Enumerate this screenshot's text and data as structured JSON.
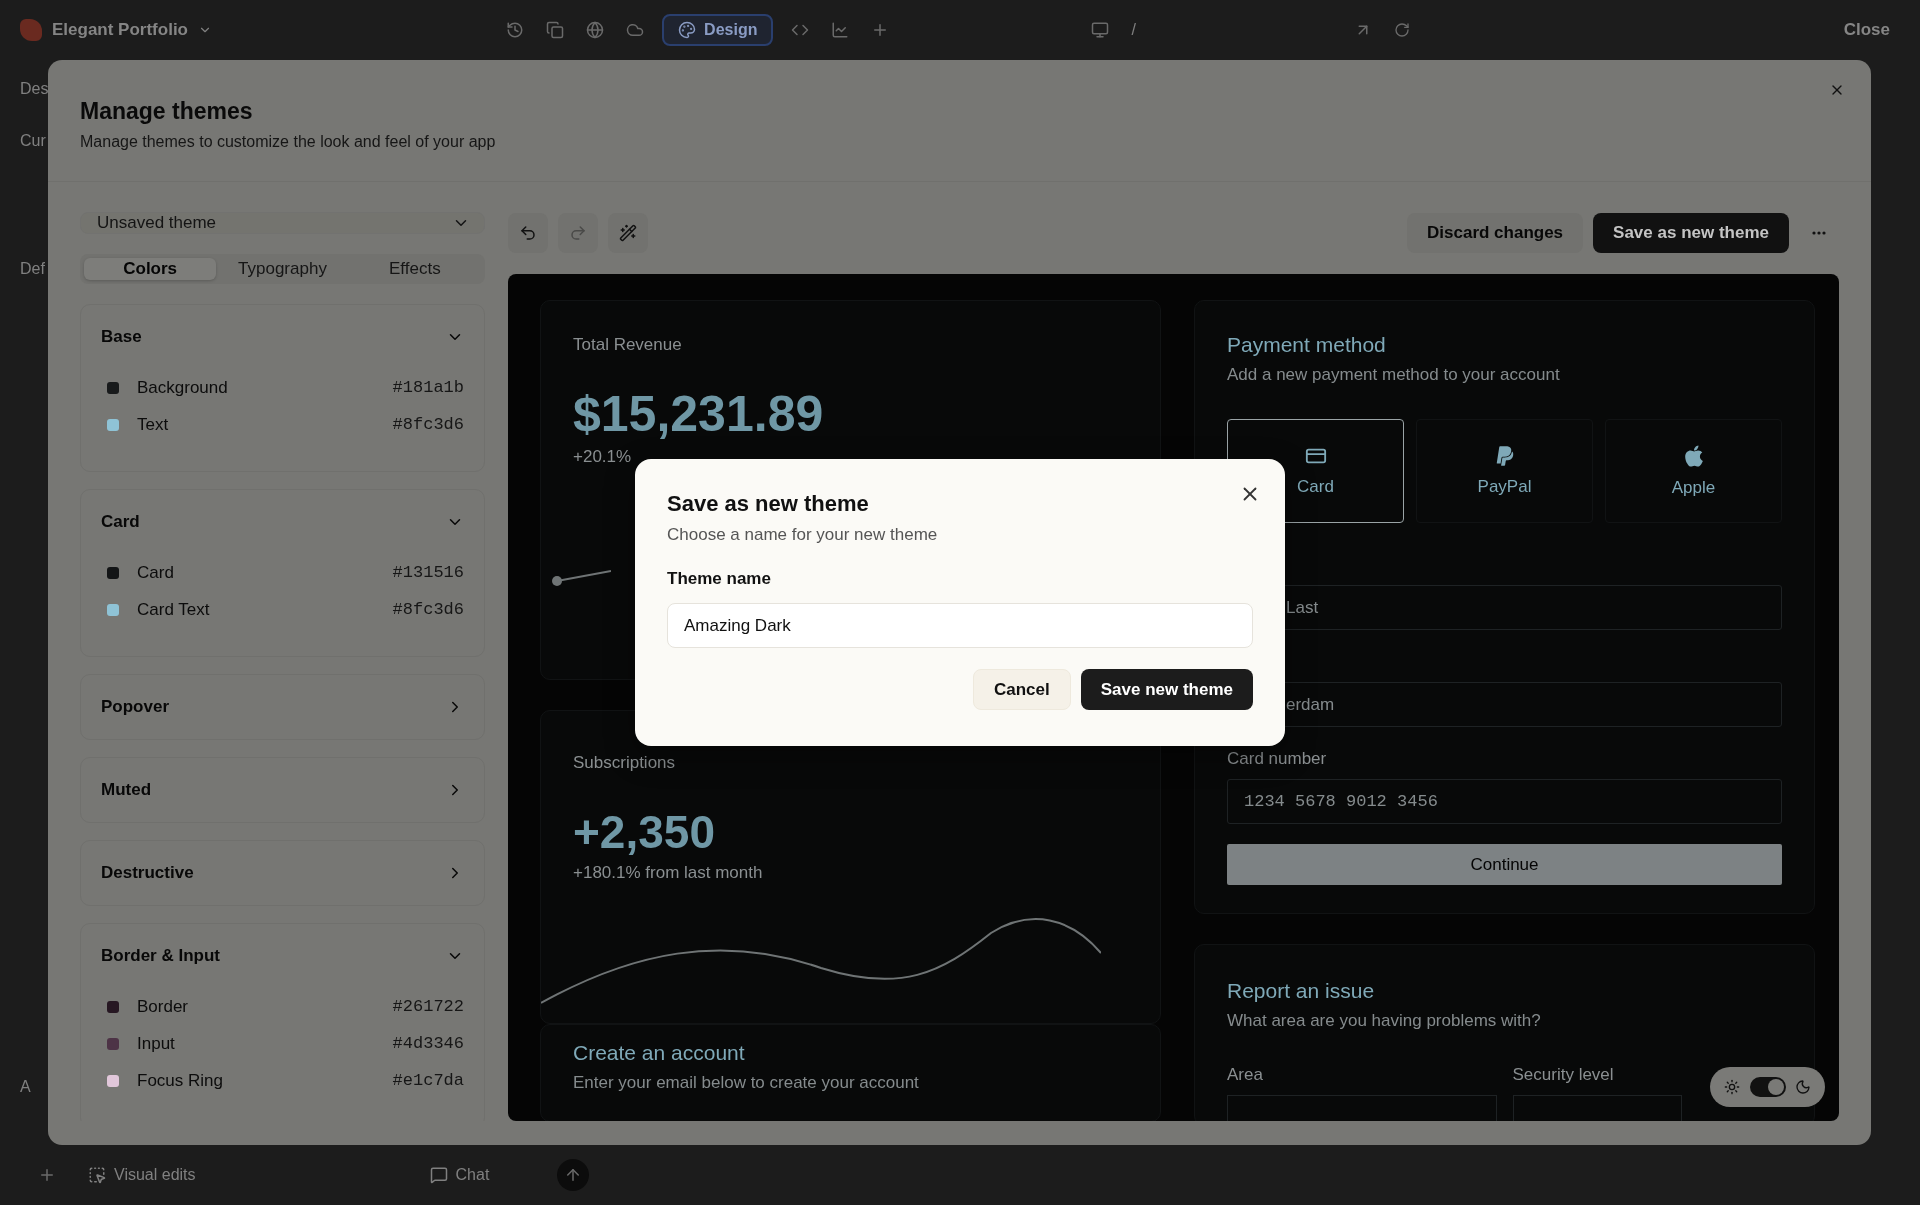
{
  "app_bar": {
    "project": "Elegant Portfolio",
    "mode": {
      "label": "Design",
      "selected": true
    },
    "path": "/",
    "close": "Close"
  },
  "background_sidebar": {
    "texts": [
      "Des",
      "Cur",
      "Def",
      "A"
    ]
  },
  "bottom_bar": {
    "visual_edits": "Visual edits",
    "chat": "Chat"
  },
  "modal": {
    "title": "Manage themes",
    "subtitle": "Manage themes to customize the look and feel of your app",
    "theme_select": {
      "value": "Unsaved theme"
    },
    "actions": {
      "discard": "Discard changes",
      "save": "Save as new theme"
    },
    "tabs": [
      {
        "label": "Colors",
        "selected": true
      },
      {
        "label": "Typography",
        "selected": false
      },
      {
        "label": "Effects",
        "selected": false
      }
    ],
    "sections": [
      {
        "name": "Base",
        "expanded": true,
        "colors": [
          {
            "name": "Background",
            "value": "#181a1b",
            "color": "#181a1b"
          },
          {
            "name": "Text",
            "value": "#8fc3d6",
            "color": "#8fc3d6"
          }
        ]
      },
      {
        "name": "Card",
        "expanded": true,
        "colors": [
          {
            "name": "Card",
            "value": "#131516",
            "color": "#131516"
          },
          {
            "name": "Card Text",
            "value": "#8fc3d6",
            "color": "#8fc3d6"
          }
        ]
      },
      {
        "name": "Popover",
        "expanded": false
      },
      {
        "name": "Muted",
        "expanded": false
      },
      {
        "name": "Destructive",
        "expanded": false
      },
      {
        "name": "Border & Input",
        "expanded": true,
        "colors": [
          {
            "name": "Border",
            "value": "#261722",
            "color": "#261722"
          },
          {
            "name": "Input",
            "value": "#4d3346",
            "color": "#4d3346"
          },
          {
            "name": "Focus Ring",
            "value": "#e1c7da",
            "color": "#e1c7da"
          }
        ]
      }
    ],
    "preview": {
      "revenue": {
        "label": "Total Revenue",
        "value": "$15,231.89",
        "change": "+20.1%"
      },
      "subscriptions": {
        "label": "Subscriptions",
        "value": "+2,350",
        "change": "+180.1% from last month"
      },
      "account": {
        "title": "Create an account",
        "subtitle": "Enter your email below to create your account"
      },
      "payment": {
        "title": "Payment method",
        "subtitle": "Add a new payment method to your account",
        "options": [
          {
            "kind": "card",
            "label": "Card",
            "selected": true
          },
          {
            "kind": "paypal",
            "label": "PayPal",
            "selected": false
          },
          {
            "kind": "apple",
            "label": "Apple",
            "selected": false
          }
        ],
        "fields": [
          {
            "placeholder": "Last"
          },
          {
            "placeholder": "erdam"
          },
          {
            "label": "Card number",
            "placeholder": "1234 5678 9012 3456"
          }
        ],
        "submit": "Continue"
      },
      "report": {
        "title": "Report an issue",
        "subtitle": "What area are you having problems with?",
        "fields": [
          "Area",
          "Security level"
        ]
      },
      "dark_mode": {
        "on": true
      }
    }
  },
  "dialog": {
    "title": "Save as new theme",
    "subtitle": "Choose a name for your new theme",
    "label": "Theme name",
    "value": "Amazing Dark",
    "cancel": "Cancel",
    "confirm": "Save new theme"
  }
}
